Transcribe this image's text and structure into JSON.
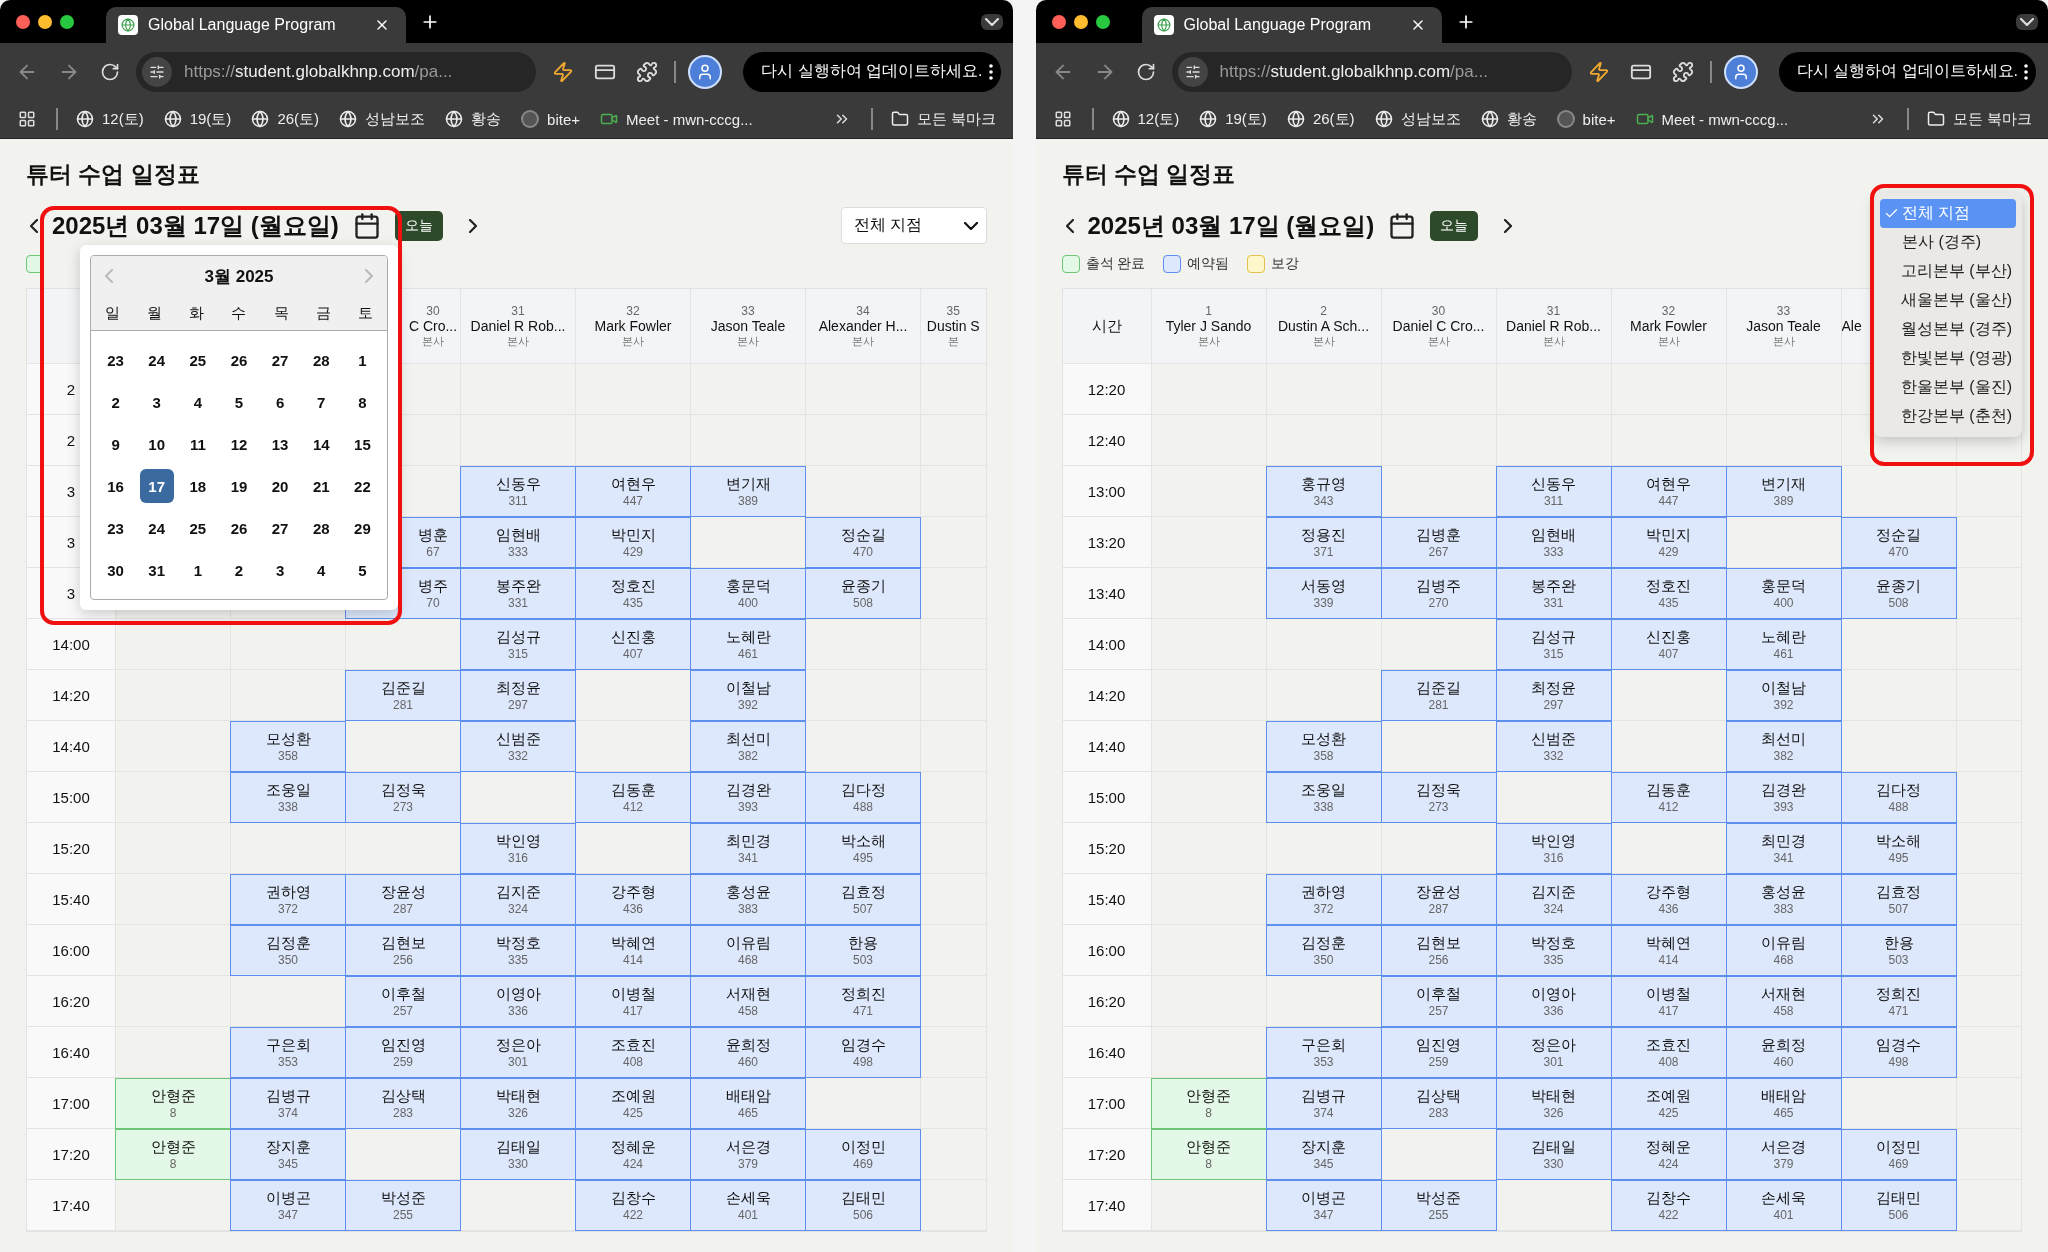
{
  "windows": [
    {
      "browser": {
        "tab_title": "Global Language Program",
        "url": {
          "scheme": "https://",
          "host": "student.globalkhnp.com",
          "rest": "/pa..."
        },
        "update_button": "다시 실행하여 업데이트하세요.",
        "bookmarks": [
          {
            "label": "12(토)",
            "kind": "globe"
          },
          {
            "label": "19(토)",
            "kind": "globe"
          },
          {
            "label": "26(토)",
            "kind": "globe"
          },
          {
            "label": "성남보조",
            "kind": "globe"
          },
          {
            "label": "황송",
            "kind": "globe"
          },
          {
            "label": "bite+",
            "kind": "site"
          },
          {
            "label": "Meet - mwn-cccg...",
            "kind": "meet"
          }
        ],
        "all_bookmarks": "모든 북마크"
      },
      "page": {
        "title": "튜터 수업 일정표",
        "date": "2025년 03월 17일 (월요일)",
        "today_button": "오늘",
        "branch_select": {
          "value": "전체 지점"
        },
        "legend": [
          {
            "kind": "attended"
          }
        ],
        "table": {
          "columns": [
            {},
            {},
            {
              "number": "30",
              "name": "C Cro...",
              "branch": "본사"
            },
            {
              "number": "31",
              "name": "Daniel R Rob...",
              "branch": "본사"
            },
            {
              "number": "32",
              "name": "Mark Fowler",
              "branch": "본사"
            },
            {
              "number": "33",
              "name": "Jason Teale",
              "branch": "본사"
            },
            {
              "number": "34",
              "name": "Alexander H...",
              "branch": "본사"
            },
            {
              "number": "35",
              "name": "Dustin S",
              "branch": "본"
            }
          ],
          "rows": [
            {
              "time": "2",
              "cells": [
                null,
                null,
                null,
                null,
                null,
                null,
                null,
                null
              ]
            },
            {
              "time": "2",
              "cells": [
                null,
                null,
                null,
                null,
                null,
                null,
                null,
                null
              ]
            },
            {
              "time": "3",
              "cells": [
                null,
                null,
                null,
                {
                  "name": "신동우",
                  "id": "311",
                  "attended": false
                },
                {
                  "name": "여현우",
                  "id": "447",
                  "attended": false
                },
                {
                  "name": "변기재",
                  "id": "389",
                  "attended": false
                },
                null,
                null
              ]
            },
            {
              "time": "3",
              "cells": [
                null,
                null,
                {
                  "name": "병훈",
                  "id": "67",
                  "attended": false
                },
                {
                  "name": "임현배",
                  "id": "333",
                  "attended": false
                },
                {
                  "name": "박민지",
                  "id": "429",
                  "attended": false
                },
                null,
                {
                  "name": "정순길",
                  "id": "470",
                  "attended": false
                },
                null
              ]
            },
            {
              "time": "3",
              "cells": [
                null,
                null,
                {
                  "name": "병주",
                  "id": "70",
                  "attended": false
                },
                {
                  "name": "봉주완",
                  "id": "331",
                  "attended": false
                },
                {
                  "name": "정호진",
                  "id": "435",
                  "attended": false
                },
                {
                  "name": "홍문덕",
                  "id": "400",
                  "attended": false
                },
                {
                  "name": "윤종기",
                  "id": "508",
                  "attended": false
                },
                null
              ]
            },
            {
              "time": "14:00",
              "cells": [
                null,
                null,
                null,
                {
                  "name": "김성규",
                  "id": "315",
                  "attended": false
                },
                {
                  "name": "신진홍",
                  "id": "407",
                  "attended": false
                },
                {
                  "name": "노혜란",
                  "id": "461",
                  "attended": false
                },
                null,
                null
              ]
            },
            {
              "time": "14:20",
              "cells": [
                null,
                null,
                {
                  "name": "김준길",
                  "id": "281",
                  "attended": false
                },
                {
                  "name": "최정윤",
                  "id": "297",
                  "attended": false
                },
                null,
                {
                  "name": "이철남",
                  "id": "392",
                  "attended": false
                },
                null,
                null
              ]
            },
            {
              "time": "14:40",
              "cells": [
                null,
                {
                  "name": "모성환",
                  "id": "358",
                  "attended": false
                },
                null,
                {
                  "name": "신범준",
                  "id": "332",
                  "attended": false
                },
                null,
                {
                  "name": "최선미",
                  "id": "382",
                  "attended": false
                },
                null,
                null
              ]
            },
            {
              "time": "15:00",
              "cells": [
                null,
                {
                  "name": "조웅일",
                  "id": "338",
                  "attended": false
                },
                {
                  "name": "김정욱",
                  "id": "273",
                  "attended": false
                },
                null,
                {
                  "name": "김동훈",
                  "id": "412",
                  "attended": false
                },
                {
                  "name": "김경완",
                  "id": "393",
                  "attended": false
                },
                {
                  "name": "김다정",
                  "id": "488",
                  "attended": false
                },
                null
              ]
            },
            {
              "time": "15:20",
              "cells": [
                null,
                null,
                null,
                {
                  "name": "박인영",
                  "id": "316",
                  "attended": false
                },
                null,
                {
                  "name": "최민경",
                  "id": "341",
                  "attended": false
                },
                {
                  "name": "박소해",
                  "id": "495",
                  "attended": false
                },
                null
              ]
            },
            {
              "time": "15:40",
              "cells": [
                null,
                {
                  "name": "권하영",
                  "id": "372",
                  "attended": false
                },
                {
                  "name": "장윤성",
                  "id": "287",
                  "attended": false
                },
                {
                  "name": "김지준",
                  "id": "324",
                  "attended": false
                },
                {
                  "name": "강주형",
                  "id": "436",
                  "attended": false
                },
                {
                  "name": "홍성윤",
                  "id": "383",
                  "attended": false
                },
                {
                  "name": "김효정",
                  "id": "507",
                  "attended": false
                },
                null
              ]
            },
            {
              "time": "16:00",
              "cells": [
                null,
                {
                  "name": "김정훈",
                  "id": "350",
                  "attended": false
                },
                {
                  "name": "김현보",
                  "id": "256",
                  "attended": false
                },
                {
                  "name": "박정호",
                  "id": "335",
                  "attended": false
                },
                {
                  "name": "박혜연",
                  "id": "414",
                  "attended": false
                },
                {
                  "name": "이유림",
                  "id": "468",
                  "attended": false
                },
                {
                  "name": "한용",
                  "id": "503",
                  "attended": false
                },
                null
              ]
            },
            {
              "time": "16:20",
              "cells": [
                null,
                null,
                {
                  "name": "이후철",
                  "id": "257",
                  "attended": false
                },
                {
                  "name": "이영아",
                  "id": "336",
                  "attended": false
                },
                {
                  "name": "이병철",
                  "id": "417",
                  "attended": false
                },
                {
                  "name": "서재현",
                  "id": "458",
                  "attended": false
                },
                {
                  "name": "정희진",
                  "id": "471",
                  "attended": false
                },
                null
              ]
            },
            {
              "time": "16:40",
              "cells": [
                null,
                {
                  "name": "구은회",
                  "id": "353",
                  "attended": false
                },
                {
                  "name": "임진영",
                  "id": "259",
                  "attended": false
                },
                {
                  "name": "정은아",
                  "id": "301",
                  "attended": false
                },
                {
                  "name": "조효진",
                  "id": "408",
                  "attended": false
                },
                {
                  "name": "윤희정",
                  "id": "460",
                  "attended": false
                },
                {
                  "name": "임경수",
                  "id": "498",
                  "attended": false
                },
                null
              ]
            },
            {
              "time": "17:00",
              "cells": [
                {
                  "name": "안형준",
                  "id": "8",
                  "attended": true
                },
                {
                  "name": "김병규",
                  "id": "374",
                  "attended": false
                },
                {
                  "name": "김상택",
                  "id": "283",
                  "attended": false
                },
                {
                  "name": "박태현",
                  "id": "326",
                  "attended": false
                },
                {
                  "name": "조예원",
                  "id": "425",
                  "attended": false
                },
                {
                  "name": "배태암",
                  "id": "465",
                  "attended": false
                },
                null,
                null
              ]
            },
            {
              "time": "17:20",
              "cells": [
                {
                  "name": "안형준",
                  "id": "8",
                  "attended": true
                },
                {
                  "name": "장지훈",
                  "id": "345",
                  "attended": false
                },
                null,
                {
                  "name": "김태일",
                  "id": "330",
                  "attended": false
                },
                {
                  "name": "정혜운",
                  "id": "424",
                  "attended": false
                },
                {
                  "name": "서은경",
                  "id": "379",
                  "attended": false
                },
                {
                  "name": "이정민",
                  "id": "469",
                  "attended": false
                },
                null
              ]
            },
            {
              "time": "17:40",
              "cells": [
                null,
                {
                  "name": "이병곤",
                  "id": "347",
                  "attended": false
                },
                {
                  "name": "박성준",
                  "id": "255",
                  "attended": false
                },
                null,
                {
                  "name": "김창수",
                  "id": "422",
                  "attended": false
                },
                {
                  "name": "손세욱",
                  "id": "401",
                  "attended": false
                },
                {
                  "name": "김태민",
                  "id": "506",
                  "attended": false
                },
                null
              ]
            }
          ]
        },
        "overlay": {
          "kind": "calendar",
          "month_title": "3월 2025",
          "weekdays": [
            "일",
            "월",
            "화",
            "수",
            "목",
            "금",
            "토"
          ],
          "days": [
            {
              "label": "23",
              "selected": false
            },
            {
              "label": "24",
              "selected": false
            },
            {
              "label": "25",
              "selected": false
            },
            {
              "label": "26",
              "selected": false
            },
            {
              "label": "27",
              "selected": false
            },
            {
              "label": "28",
              "selected": false
            },
            {
              "label": "1",
              "selected": false
            },
            {
              "label": "2",
              "selected": false
            },
            {
              "label": "3",
              "selected": false
            },
            {
              "label": "4",
              "selected": false
            },
            {
              "label": "5",
              "selected": false
            },
            {
              "label": "6",
              "selected": false
            },
            {
              "label": "7",
              "selected": false
            },
            {
              "label": "8",
              "selected": false
            },
            {
              "label": "9",
              "selected": false
            },
            {
              "label": "10",
              "selected": false
            },
            {
              "label": "11",
              "selected": false
            },
            {
              "label": "12",
              "selected": false
            },
            {
              "label": "13",
              "selected": false
            },
            {
              "label": "14",
              "selected": false
            },
            {
              "label": "15",
              "selected": false
            },
            {
              "label": "16",
              "selected": false
            },
            {
              "label": "17",
              "selected": true
            },
            {
              "label": "18",
              "selected": false
            },
            {
              "label": "19",
              "selected": false
            },
            {
              "label": "20",
              "selected": false
            },
            {
              "label": "21",
              "selected": false
            },
            {
              "label": "22",
              "selected": false
            },
            {
              "label": "23",
              "selected": false
            },
            {
              "label": "24",
              "selected": false
            },
            {
              "label": "25",
              "selected": false
            },
            {
              "label": "26",
              "selected": false
            },
            {
              "label": "27",
              "selected": false
            },
            {
              "label": "28",
              "selected": false
            },
            {
              "label": "29",
              "selected": false
            },
            {
              "label": "30",
              "selected": false
            },
            {
              "label": "31",
              "selected": false
            },
            {
              "label": "1",
              "selected": false
            },
            {
              "label": "2",
              "selected": false
            },
            {
              "label": "3",
              "selected": false
            },
            {
              "label": "4",
              "selected": false
            },
            {
              "label": "5",
              "selected": false
            }
          ]
        }
      }
    },
    {
      "browser": {
        "tab_title": "Global Language Program",
        "url": {
          "scheme": "https://",
          "host": "student.globalkhnp.com",
          "rest": "/pa..."
        },
        "update_button": "다시 실행하여 업데이트하세요.",
        "bookmarks": [
          {
            "label": "12(토)",
            "kind": "globe"
          },
          {
            "label": "19(토)",
            "kind": "globe"
          },
          {
            "label": "26(토)",
            "kind": "globe"
          },
          {
            "label": "성남보조",
            "kind": "globe"
          },
          {
            "label": "황송",
            "kind": "globe"
          },
          {
            "label": "bite+",
            "kind": "site"
          },
          {
            "label": "Meet - mwn-cccg...",
            "kind": "meet"
          }
        ],
        "all_bookmarks": "모든 북마크"
      },
      "page": {
        "title": "튜터 수업 일정표",
        "date": "2025년 03월 17일 (월요일)",
        "today_button": "오늘",
        "legend": [
          {
            "kind": "attended",
            "label": "출석 완료"
          },
          {
            "kind": "reserved",
            "label": "예약됨"
          },
          {
            "kind": "makeup",
            "label": "보강"
          }
        ],
        "table": {
          "time_header": "시간",
          "columns": [
            {
              "number": "1",
              "name": "Tyler J Sando",
              "branch": "본사"
            },
            {
              "number": "2",
              "name": "Dustin A Sch...",
              "branch": "본사"
            },
            {
              "number": "30",
              "name": "Daniel C Cro...",
              "branch": "본사"
            },
            {
              "number": "31",
              "name": "Daniel R Rob...",
              "branch": "본사"
            },
            {
              "number": "32",
              "name": "Mark Fowler",
              "branch": "본사"
            },
            {
              "number": "33",
              "name": "Jason Teale",
              "branch": "본사"
            },
            {
              "name": "Ale"
            },
            {}
          ],
          "rows": [
            {
              "time": "12:20",
              "cells": [
                null,
                null,
                null,
                null,
                null,
                null,
                null,
                null
              ]
            },
            {
              "time": "12:40",
              "cells": [
                null,
                null,
                null,
                null,
                null,
                null,
                null,
                null
              ]
            },
            {
              "time": "13:00",
              "cells": [
                null,
                {
                  "name": "홍규영",
                  "id": "343",
                  "attended": false
                },
                null,
                {
                  "name": "신동우",
                  "id": "311",
                  "attended": false
                },
                {
                  "name": "여현우",
                  "id": "447",
                  "attended": false
                },
                {
                  "name": "변기재",
                  "id": "389",
                  "attended": false
                },
                null,
                null
              ]
            },
            {
              "time": "13:20",
              "cells": [
                null,
                {
                  "name": "정용진",
                  "id": "371",
                  "attended": false
                },
                {
                  "name": "김병훈",
                  "id": "267",
                  "attended": false
                },
                {
                  "name": "임현배",
                  "id": "333",
                  "attended": false
                },
                {
                  "name": "박민지",
                  "id": "429",
                  "attended": false
                },
                null,
                {
                  "name": "정순길",
                  "id": "470",
                  "attended": false
                },
                null
              ]
            },
            {
              "time": "13:40",
              "cells": [
                null,
                {
                  "name": "서동영",
                  "id": "339",
                  "attended": false
                },
                {
                  "name": "김병주",
                  "id": "270",
                  "attended": false
                },
                {
                  "name": "봉주완",
                  "id": "331",
                  "attended": false
                },
                {
                  "name": "정호진",
                  "id": "435",
                  "attended": false
                },
                {
                  "name": "홍문덕",
                  "id": "400",
                  "attended": false
                },
                {
                  "name": "윤종기",
                  "id": "508",
                  "attended": false
                },
                null
              ]
            },
            {
              "time": "14:00",
              "cells": [
                null,
                null,
                null,
                {
                  "name": "김성규",
                  "id": "315",
                  "attended": false
                },
                {
                  "name": "신진홍",
                  "id": "407",
                  "attended": false
                },
                {
                  "name": "노혜란",
                  "id": "461",
                  "attended": false
                },
                null,
                null
              ]
            },
            {
              "time": "14:20",
              "cells": [
                null,
                null,
                {
                  "name": "김준길",
                  "id": "281",
                  "attended": false
                },
                {
                  "name": "최정윤",
                  "id": "297",
                  "attended": false
                },
                null,
                {
                  "name": "이철남",
                  "id": "392",
                  "attended": false
                },
                null,
                null
              ]
            },
            {
              "time": "14:40",
              "cells": [
                null,
                {
                  "name": "모성환",
                  "id": "358",
                  "attended": false
                },
                null,
                {
                  "name": "신범준",
                  "id": "332",
                  "attended": false
                },
                null,
                {
                  "name": "최선미",
                  "id": "382",
                  "attended": false
                },
                null,
                null
              ]
            },
            {
              "time": "15:00",
              "cells": [
                null,
                {
                  "name": "조웅일",
                  "id": "338",
                  "attended": false
                },
                {
                  "name": "김정욱",
                  "id": "273",
                  "attended": false
                },
                null,
                {
                  "name": "김동훈",
                  "id": "412",
                  "attended": false
                },
                {
                  "name": "김경완",
                  "id": "393",
                  "attended": false
                },
                {
                  "name": "김다정",
                  "id": "488",
                  "attended": false
                },
                null
              ]
            },
            {
              "time": "15:20",
              "cells": [
                null,
                null,
                null,
                {
                  "name": "박인영",
                  "id": "316",
                  "attended": false
                },
                null,
                {
                  "name": "최민경",
                  "id": "341",
                  "attended": false
                },
                {
                  "name": "박소해",
                  "id": "495",
                  "attended": false
                },
                null
              ]
            },
            {
              "time": "15:40",
              "cells": [
                null,
                {
                  "name": "권하영",
                  "id": "372",
                  "attended": false
                },
                {
                  "name": "장윤성",
                  "id": "287",
                  "attended": false
                },
                {
                  "name": "김지준",
                  "id": "324",
                  "attended": false
                },
                {
                  "name": "강주형",
                  "id": "436",
                  "attended": false
                },
                {
                  "name": "홍성윤",
                  "id": "383",
                  "attended": false
                },
                {
                  "name": "김효정",
                  "id": "507",
                  "attended": false
                },
                null
              ]
            },
            {
              "time": "16:00",
              "cells": [
                null,
                {
                  "name": "김정훈",
                  "id": "350",
                  "attended": false
                },
                {
                  "name": "김현보",
                  "id": "256",
                  "attended": false
                },
                {
                  "name": "박정호",
                  "id": "335",
                  "attended": false
                },
                {
                  "name": "박혜연",
                  "id": "414",
                  "attended": false
                },
                {
                  "name": "이유림",
                  "id": "468",
                  "attended": false
                },
                {
                  "name": "한용",
                  "id": "503",
                  "attended": false
                },
                null
              ]
            },
            {
              "time": "16:20",
              "cells": [
                null,
                null,
                {
                  "name": "이후철",
                  "id": "257",
                  "attended": false
                },
                {
                  "name": "이영아",
                  "id": "336",
                  "attended": false
                },
                {
                  "name": "이병철",
                  "id": "417",
                  "attended": false
                },
                {
                  "name": "서재현",
                  "id": "458",
                  "attended": false
                },
                {
                  "name": "정희진",
                  "id": "471",
                  "attended": false
                },
                null
              ]
            },
            {
              "time": "16:40",
              "cells": [
                null,
                {
                  "name": "구은회",
                  "id": "353",
                  "attended": false
                },
                {
                  "name": "임진영",
                  "id": "259",
                  "attended": false
                },
                {
                  "name": "정은아",
                  "id": "301",
                  "attended": false
                },
                {
                  "name": "조효진",
                  "id": "408",
                  "attended": false
                },
                {
                  "name": "윤희정",
                  "id": "460",
                  "attended": false
                },
                {
                  "name": "임경수",
                  "id": "498",
                  "attended": false
                },
                null
              ]
            },
            {
              "time": "17:00",
              "cells": [
                {
                  "name": "안형준",
                  "id": "8",
                  "attended": true
                },
                {
                  "name": "김병규",
                  "id": "374",
                  "attended": false
                },
                {
                  "name": "김상택",
                  "id": "283",
                  "attended": false
                },
                {
                  "name": "박태현",
                  "id": "326",
                  "attended": false
                },
                {
                  "name": "조예원",
                  "id": "425",
                  "attended": false
                },
                {
                  "name": "배태암",
                  "id": "465",
                  "attended": false
                },
                null,
                null
              ]
            },
            {
              "time": "17:20",
              "cells": [
                {
                  "name": "안형준",
                  "id": "8",
                  "attended": true
                },
                {
                  "name": "장지훈",
                  "id": "345",
                  "attended": false
                },
                null,
                {
                  "name": "김태일",
                  "id": "330",
                  "attended": false
                },
                {
                  "name": "정혜운",
                  "id": "424",
                  "attended": false
                },
                {
                  "name": "서은경",
                  "id": "379",
                  "attended": false
                },
                {
                  "name": "이정민",
                  "id": "469",
                  "attended": false
                },
                null
              ]
            },
            {
              "time": "17:40",
              "cells": [
                null,
                {
                  "name": "이병곤",
                  "id": "347",
                  "attended": false
                },
                {
                  "name": "박성준",
                  "id": "255",
                  "attended": false
                },
                null,
                {
                  "name": "김창수",
                  "id": "422",
                  "attended": false
                },
                {
                  "name": "손세욱",
                  "id": "401",
                  "attended": false
                },
                {
                  "name": "김태민",
                  "id": "506",
                  "attended": false
                },
                null
              ]
            }
          ]
        },
        "overlay": {
          "kind": "dropdown",
          "options": [
            {
              "label": "전체 지점",
              "selected": true
            },
            {
              "label": "본사 (경주)",
              "selected": false
            },
            {
              "label": "고리본부 (부산)",
              "selected": false
            },
            {
              "label": "새울본부 (울산)",
              "selected": false
            },
            {
              "label": "월성본부 (경주)",
              "selected": false
            },
            {
              "label": "한빛본부 (영광)",
              "selected": false
            },
            {
              "label": "한울본부 (울진)",
              "selected": false
            },
            {
              "label": "한강본부 (춘천)",
              "selected": false
            }
          ]
        }
      }
    }
  ]
}
